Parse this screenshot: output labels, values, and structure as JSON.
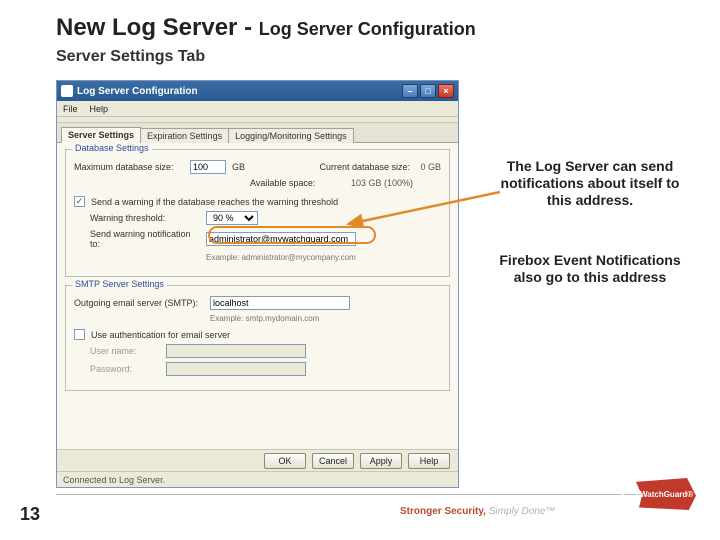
{
  "slide": {
    "heading_main": "New Log Server - ",
    "heading_sub": "Log Server Configuration",
    "subtitle": "Server Settings Tab",
    "page_number": "13",
    "tagline_strong": "Stronger Security, ",
    "tagline_em": "Simply Done™",
    "logo_text": "WatchGuard®"
  },
  "window": {
    "title": "Log Server Configuration",
    "menu": {
      "file": "File",
      "help": "Help"
    },
    "tabs": {
      "server_settings": "Server Settings",
      "expiration_settings": "Expiration Settings",
      "logging_settings": "Logging/Monitoring Settings"
    },
    "database": {
      "group_title": "Database Settings",
      "max_label": "Maximum database size:",
      "max_value": "100",
      "max_unit": "GB",
      "current_label": "Current database size:",
      "current_value": "0 GB",
      "available_label": "Available space:",
      "available_value": "103 GB (100%)",
      "warn_checkbox": "Send a warning if the database reaches the warning threshold",
      "warn_threshold_label": "Warning threshold:",
      "warn_threshold_value": "90 %",
      "notif_label": "Send warning notification to:",
      "notif_value": "administrator@mywatchguard.com",
      "notif_example": "Example: administrator@mycompany.com"
    },
    "smtp": {
      "group_title": "SMTP Server Settings",
      "server_label": "Outgoing email server (SMTP):",
      "server_value": "localhost",
      "server_example": "Example: smtp.mydomain.com",
      "auth_checkbox": "Use authentication for email server",
      "user_label": "User name:",
      "pass_label": "Password:"
    },
    "buttons": {
      "ok": "OK",
      "cancel": "Cancel",
      "apply": "Apply",
      "help": "Help"
    },
    "status": "Connected to Log Server."
  },
  "annotations": {
    "a1": "The Log Server can send notifications about itself to this address.",
    "a2": "Firebox Event Notifications also go to this address"
  },
  "icons": {
    "minimize": "–",
    "maximize": "□",
    "close": "×"
  }
}
